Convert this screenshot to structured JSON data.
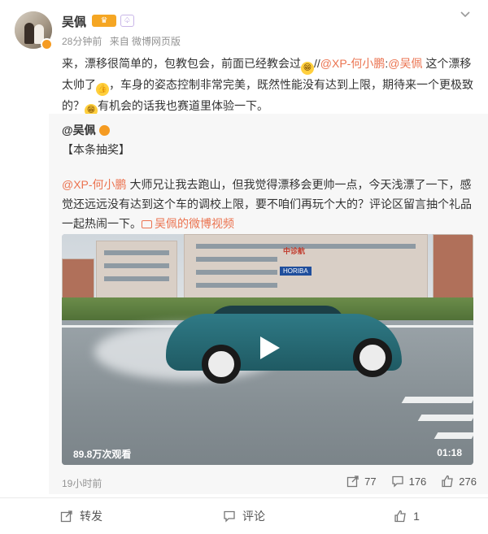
{
  "post": {
    "author": "吴佩",
    "crown_badge": "♛",
    "level_badge": "♤",
    "time": "28分钟前",
    "source": "来自 微博网页版",
    "text_parts": [
      {
        "t": "来，漂移很简单的，包教包会，前面已经教会过",
        "link": false
      },
      {
        "t": "",
        "emoji": "grin"
      },
      {
        "t": "//",
        "link": false
      },
      {
        "t": "@XP-何小鹏",
        "link": true
      },
      {
        "t": ":",
        "link": false
      },
      {
        "t": "@吴佩",
        "link": true
      },
      {
        "t": " 这个漂移太帅了",
        "link": false
      },
      {
        "t": "",
        "emoji": "thumb"
      },
      {
        "t": "，车身的姿态控制非常完美，既然性能没有达到上限，期待来一个更极致的？",
        "link": false
      },
      {
        "t": "",
        "emoji": "grin"
      },
      {
        "t": "有机会的话我也赛道里体验一下。",
        "link": false
      }
    ]
  },
  "repost": {
    "author": "@吴佩",
    "tag": "【本条抽奖】",
    "mention": "@XP-何小鹏",
    "body": " 大师兄让我去跑山，但我觉得漂移会更帅一点，今天浅漂了一下，感觉还远远没有达到这个车的调校上限，要不咱们再玩个大的？评论区留言抽个礼品一起热闹一下。",
    "video_link": "吴佩的微博视频",
    "video": {
      "sign_1": "中诊航",
      "sign_2": "HORIBA",
      "views": "89.8万次观看",
      "duration": "01:18"
    },
    "time": "19小时前",
    "reposts": "77",
    "comments": "176",
    "likes": "276"
  },
  "actions": {
    "repost": "转发",
    "comment": "评论",
    "like": "1"
  },
  "colors": {
    "link": "#eb7350",
    "meta": "#939393",
    "repost_bg": "#f7f7f7"
  }
}
